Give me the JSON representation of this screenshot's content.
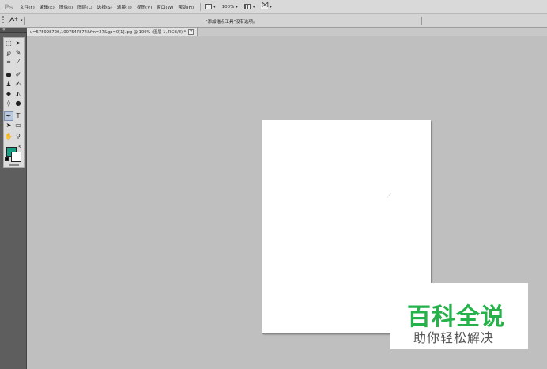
{
  "app": {
    "logo": "Ps"
  },
  "menu": {
    "items": [
      "文件(F)",
      "编辑(E)",
      "图像(I)",
      "图层(L)",
      "选择(S)",
      "滤镜(T)",
      "视图(V)",
      "窗口(W)",
      "帮助(H)"
    ],
    "zoom_label": "100%"
  },
  "options_bar": {
    "message": "\"添加锚点工具\"没有选项。"
  },
  "document": {
    "tab_title": "u=575998720,1007547874&fm=27&gp=0[1].jpg @ 100% (图层 1, RGB/8) *"
  },
  "colors": {
    "foreground": "#16a085",
    "background": "#ffffff",
    "canvas": "#ffffff",
    "workspace": "#bfbfbf"
  },
  "watermark": {
    "title": "百科全说",
    "subtitle": "助你轻松解决"
  }
}
